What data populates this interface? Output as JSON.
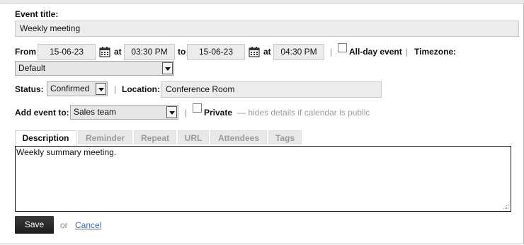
{
  "event_title": {
    "label": "Event title:",
    "value": "Weekly meeting"
  },
  "timing": {
    "from_label": "From",
    "start_date": "15-06-23",
    "start_time": "03:30 PM",
    "at_label": "at",
    "to_label": "to",
    "end_date": "15-06-23",
    "end_time": "04:30 PM",
    "all_day_label": "All-day event",
    "timezone_label": "Timezone:",
    "timezone_value": "Default"
  },
  "status": {
    "label": "Status:",
    "value": "Confirmed"
  },
  "location": {
    "label": "Location:",
    "value": "Conference Room"
  },
  "calendar": {
    "label": "Add event to:",
    "value": "Sales team",
    "private_label": "Private",
    "private_hint": "— hides details if calendar is public"
  },
  "separator": "|",
  "tabs": [
    {
      "label": "Description"
    },
    {
      "label": "Reminder"
    },
    {
      "label": "Repeat"
    },
    {
      "label": "URL"
    },
    {
      "label": "Attendees"
    },
    {
      "label": "Tags"
    }
  ],
  "description_text": "Weekly summary meeting.",
  "actions": {
    "save": "Save",
    "or": "or",
    "cancel": "Cancel"
  }
}
